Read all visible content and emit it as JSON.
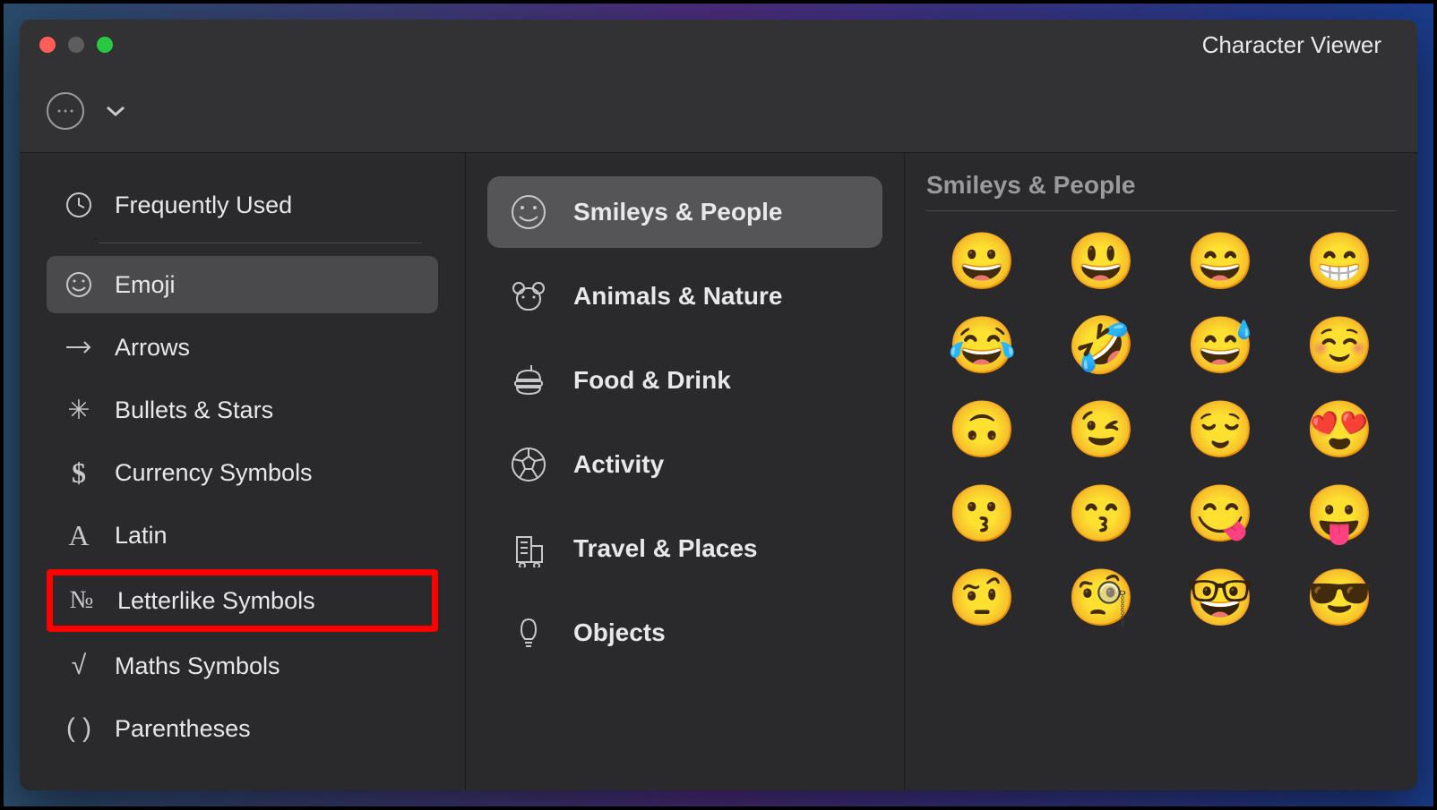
{
  "window": {
    "title": "Character Viewer"
  },
  "sidebar": {
    "items": [
      {
        "icon": "clock",
        "label": "Frequently Used"
      },
      {
        "icon": "smiley",
        "label": "Emoji",
        "selected": true
      },
      {
        "icon": "arrow",
        "label": "Arrows"
      },
      {
        "icon": "asterisk",
        "label": "Bullets & Stars"
      },
      {
        "icon": "dollar",
        "label": "Currency Symbols"
      },
      {
        "icon": "latin-a",
        "label": "Latin"
      },
      {
        "icon": "numero",
        "label": "Letterlike Symbols",
        "highlighted": true
      },
      {
        "icon": "sqrt",
        "label": "Maths Symbols"
      },
      {
        "icon": "parens",
        "label": "Parentheses"
      }
    ]
  },
  "categories": {
    "items": [
      {
        "icon": "smiley",
        "label": "Smileys & People",
        "selected": true
      },
      {
        "icon": "bear",
        "label": "Animals & Nature"
      },
      {
        "icon": "burger",
        "label": "Food & Drink"
      },
      {
        "icon": "soccer",
        "label": "Activity"
      },
      {
        "icon": "building",
        "label": "Travel & Places"
      },
      {
        "icon": "bulb",
        "label": "Objects"
      }
    ]
  },
  "emoji_panel": {
    "header": "Smileys & People",
    "emojis": [
      "😀",
      "😃",
      "😄",
      "😁",
      "😂",
      "🤣",
      "😅",
      "☺️",
      "🙃",
      "😉",
      "😌",
      "😍",
      "😗",
      "😙",
      "😋",
      "😛",
      "🤨",
      "🧐",
      "🤓",
      "😎"
    ]
  }
}
